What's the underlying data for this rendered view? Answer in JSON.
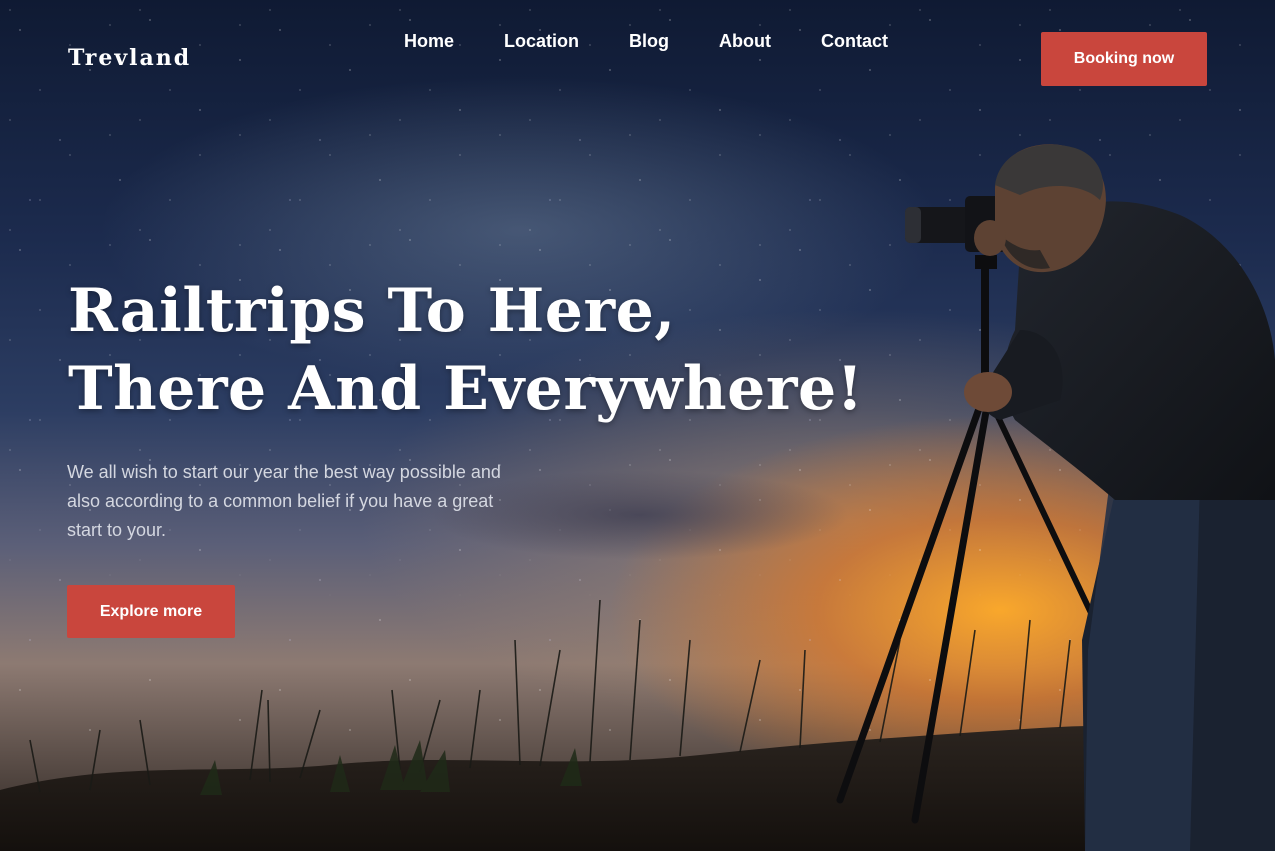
{
  "brand": {
    "name": "Trevland"
  },
  "nav": {
    "items": [
      {
        "label": "Home"
      },
      {
        "label": "Location"
      },
      {
        "label": "Blog"
      },
      {
        "label": "About"
      },
      {
        "label": "Contact"
      }
    ]
  },
  "header": {
    "booking_label": "Booking now"
  },
  "hero": {
    "headline_line1": "Railtrips To Here,",
    "headline_line2": "There And Everywhere!",
    "subtext": "We all wish to start our year the best way possible and also according to a common belief if you have a great start to your.",
    "cta_label": "Explore more"
  },
  "colors": {
    "accent": "#c9463d",
    "text_light": "#ffffff",
    "subtext": "#d4d7e0"
  },
  "background": {
    "subject": "photographer-with-tripod-camera-silhouette",
    "scene": "starry-night-sky-with-sunset-horizon"
  }
}
